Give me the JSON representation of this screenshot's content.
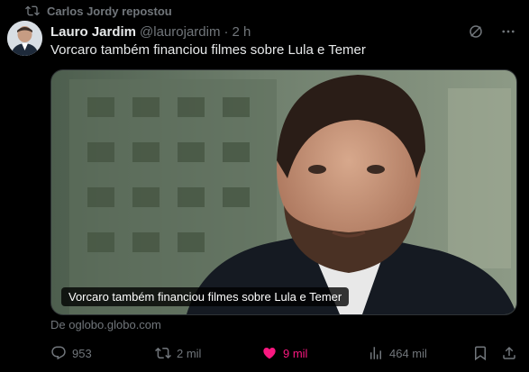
{
  "repost": {
    "label": "Carlos Jordy repostou",
    "icon": "repost-icon"
  },
  "tweet": {
    "author_name": "Lauro Jardim",
    "handle": "@laurojardim",
    "separator": "·",
    "time": "2 h",
    "text": "Vorcaro também financiou filmes sobre Lula e Temer",
    "media_caption": "Vorcaro também financiou filmes sobre Lula e Temer",
    "source": "De oglobo.globo.com"
  },
  "actions": {
    "replies": "953",
    "reposts": "2 mil",
    "likes": "9 mil",
    "views": "464 mil"
  },
  "colors": {
    "background": "#000000",
    "text": "#e7e9ea",
    "muted": "#71767b",
    "like": "#f91880"
  }
}
